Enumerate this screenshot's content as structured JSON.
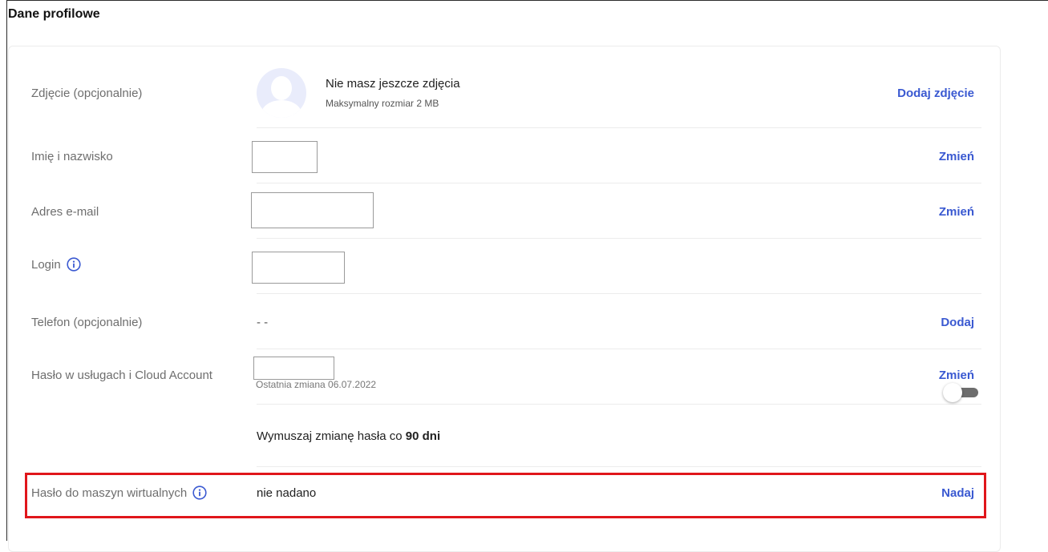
{
  "section": {
    "title": "Dane profilowe"
  },
  "photo": {
    "label": "Zdjęcie (opcjonalnie)",
    "title": "Nie masz jeszcze zdjęcia",
    "subtitle": "Maksymalny rozmiar 2 MB",
    "action": "Dodaj zdjęcie"
  },
  "name": {
    "label": "Imię i nazwisko",
    "value": "",
    "action": "Zmień"
  },
  "email": {
    "label": "Adres e-mail",
    "value": "",
    "action": "Zmień"
  },
  "login": {
    "label": "Login",
    "value": ""
  },
  "phone": {
    "label": "Telefon (opcjonalnie)",
    "value": "- -",
    "action": "Dodaj"
  },
  "password": {
    "label": "Hasło w usługach i Cloud Account",
    "value": "",
    "last_change": "Ostatnia zmiana 06.07.2022",
    "action": "Zmień"
  },
  "force_change": {
    "text": "Wymuszaj zmianę hasła co ",
    "days": "90 dni",
    "enabled": false
  },
  "vm_password": {
    "label": "Hasło do maszyn wirtualnych",
    "value": "nie nadano",
    "action": "Nadaj"
  },
  "colors": {
    "accent": "#3a59d1",
    "highlight": "#e0161b",
    "label": "#6e6e6e"
  },
  "icons": {
    "info": "info-icon",
    "avatar": "user-avatar-icon"
  }
}
